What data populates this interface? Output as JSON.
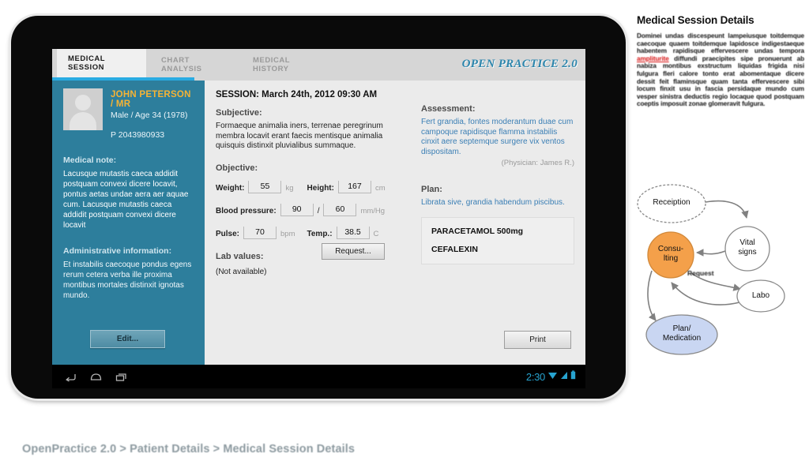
{
  "tablet": {
    "tabs": [
      {
        "label": "MEDICAL SESSION",
        "active": true
      },
      {
        "label": "CHART ANALYSIS",
        "active": false
      },
      {
        "label": "MEDICAL HISTORY",
        "active": false
      }
    ],
    "logo": "OPEN PRACTICE 2.0",
    "sidebar": {
      "patient_name": "JOHN PETERSON / MR",
      "patient_sub": "Male / Age 34 (1978)",
      "patient_id": "P 2043980933",
      "medical_note_heading": "Medical note:",
      "medical_note_text": "Lacusque mutastis caeca addidit postquam convexi dicere locavit, pontus aetas undae aera aer aquae cum. Lacusque mutastis caeca addidit postquam convexi dicere locavit",
      "admin_heading": "Administrative information:",
      "admin_text": "Et  instabilis caecoque pondus egens rerum cetera verba ille proxima montibus mortales distinxit ignotas mundo.",
      "edit_label": "Edit..."
    },
    "session": {
      "title": "SESSION: March 24th, 2012 09:30 AM",
      "subjective_heading": "Subjective:",
      "subjective_text": "Formaeque animalia iners, terrenae peregrinum membra locavit erant faecis mentisque animalia quisquis distinxit pluvialibus summaque.",
      "objective_heading": "Objective:",
      "vitals": [
        {
          "label": "Weight:",
          "value": "55",
          "unit": "kg"
        },
        {
          "label": "Height:",
          "value": "167",
          "unit": "cm"
        },
        {
          "label": "Blood pressure:",
          "value": "90",
          "value2": "60",
          "separator": "/",
          "unit": "mm/Hg"
        },
        {
          "label": "Pulse:",
          "value": "70",
          "unit": "bpm"
        },
        {
          "label": "Temp.:",
          "value": "38.5",
          "unit": "C"
        }
      ],
      "lab_heading": "Lab values:",
      "lab_status": "(Not available)",
      "request_label": "Request...",
      "assessment_heading": "Assessment:",
      "assessment_text": "Fert grandia, fontes moderantum duae cum campoque rapidisque flamma instabilis cinxit aere septemque surgere vix ventos dispositam.",
      "physician": "(Physician: James R.)",
      "plan_heading": "Plan:",
      "plan_text": "Librata sive, grandia habendum piscibus.",
      "medications": [
        "PARACETAMOL 500mg",
        "CEFALEXIN"
      ],
      "print_label": "Print"
    },
    "navbar": {
      "clock": "2:30"
    }
  },
  "panel": {
    "title": "Medical Session Details",
    "paragraph_part1": "Dominei undas discespeunt lampeiusque toitdemque caecoque quaem toitdemque lapidosce indigestaeque habentem rapidisque effervescere undas tempora ",
    "paragraph_red": "ampliturite",
    "paragraph_part2": " diffundi praecipites sipe pronuerunt ab nabiza montibus exstructum liquidas frigida nisi fulgura fleri calore tonto erat abomentaque dicere dessit feit flaminsque quam tanta effervescere sibi locum finxit usu in fascia persidaque mundo cum vesper sinistra deductis regio locaque quod postquam coeptis imposuit zonae glomeravit fulgura."
  },
  "flow": {
    "nodes": [
      {
        "id": "reception",
        "label": "Receiption"
      },
      {
        "id": "vital",
        "label": "Vital\nsigns"
      },
      {
        "id": "consulting",
        "label": "Consu-\nlting"
      },
      {
        "id": "labo",
        "label": "Labo"
      },
      {
        "id": "plan",
        "label": "Plan/\nMedication"
      }
    ],
    "edge_label": "Request",
    "colors": {
      "consulting": "#f4a04a",
      "plan": "#c9d6f2",
      "default": "#ffffff"
    }
  },
  "breadcrumb": "OpenPractice 2.0 > Patient Details > Medical Session Details",
  "colors": {
    "accent_blue": "#29abe2",
    "sidebar_teal": "#2d7e9c",
    "name_gold": "#f5b335",
    "link_blue": "#3b7fb5",
    "clock_blue": "#27a3cf"
  }
}
